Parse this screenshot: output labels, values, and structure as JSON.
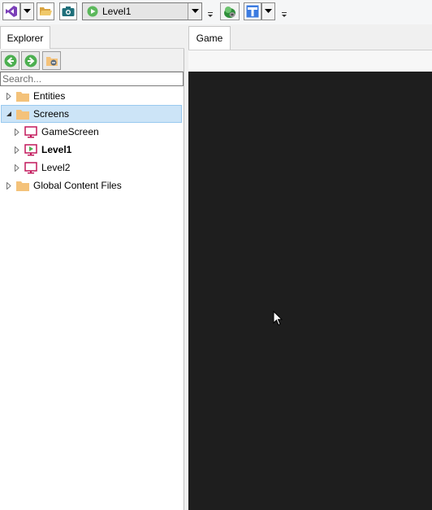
{
  "toolbar": {
    "screen_combo_value": "Level1"
  },
  "explorer": {
    "tab_label": "Explorer",
    "search_placeholder": "Search...",
    "tree": [
      {
        "label": "Entities",
        "level": 0,
        "expanded": false,
        "icon": "folder-icon",
        "bold": false,
        "selected": false
      },
      {
        "label": "Screens",
        "level": 0,
        "expanded": true,
        "icon": "folder-icon",
        "bold": false,
        "selected": true
      },
      {
        "label": "GameScreen",
        "level": 1,
        "expanded": false,
        "icon": "screen-icon",
        "bold": false,
        "selected": false
      },
      {
        "label": "Level1",
        "level": 1,
        "expanded": false,
        "icon": "start-screen-icon",
        "bold": true,
        "selected": false
      },
      {
        "label": "Level2",
        "level": 1,
        "expanded": false,
        "icon": "screen-icon",
        "bold": false,
        "selected": false
      },
      {
        "label": "Global Content Files",
        "level": 0,
        "expanded": false,
        "icon": "folder-icon",
        "bold": false,
        "selected": false
      }
    ]
  },
  "game": {
    "tab_label": "Game"
  },
  "colors": {
    "selection": "#cce4f7",
    "folder": "#f4c27a",
    "screen_icon": "#c2185b",
    "game_background": "#1e1e1e"
  }
}
